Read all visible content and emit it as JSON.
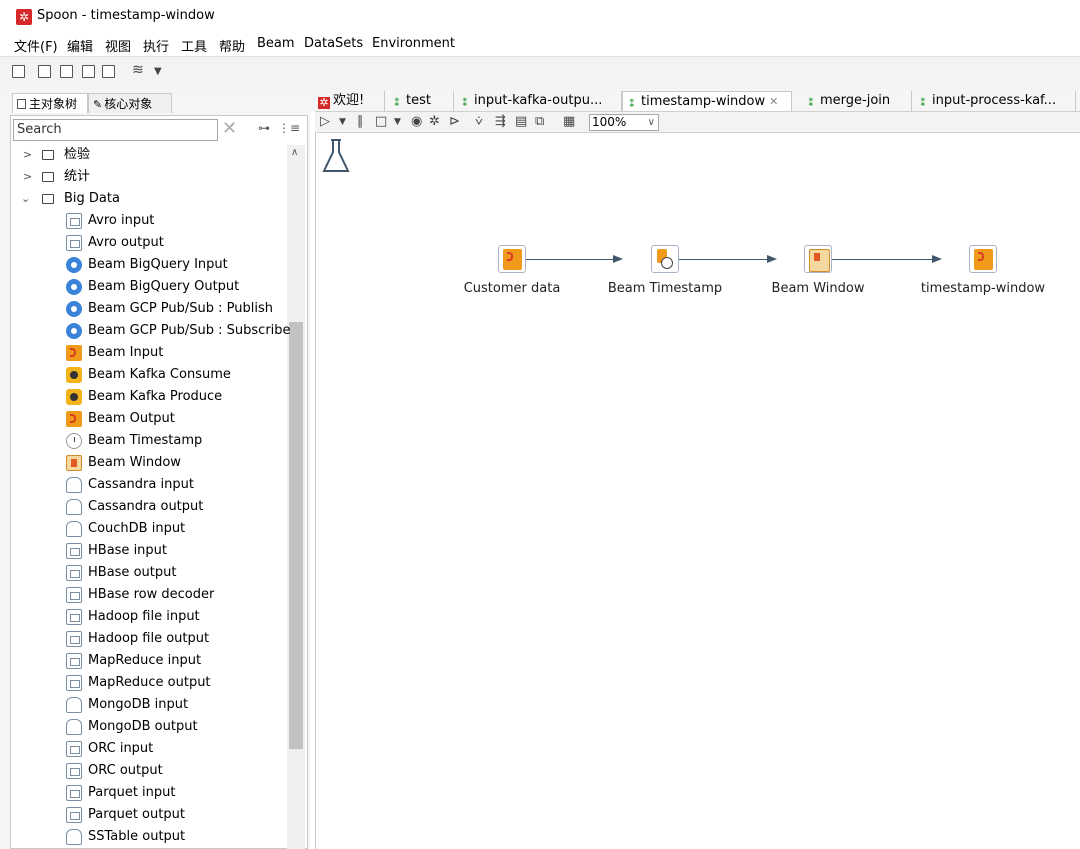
{
  "window": {
    "title": "Spoon - timestamp-window",
    "icon": "spoon-app-icon"
  },
  "menubar": [
    "文件(F)",
    "编辑",
    "视图",
    "执行",
    "工具",
    "帮助",
    "Beam",
    "DataSets",
    "Environment"
  ],
  "toolbar": {
    "icons": [
      "new-file-icon",
      "open-file-icon",
      "explore-repository-icon",
      "save-icon",
      "save-as-icon",
      "perspective-icon",
      "dropdown-arrow-icon"
    ]
  },
  "left_panel": {
    "tabs": [
      "主对象树",
      "核心对象"
    ],
    "search": {
      "placeholder": "Search",
      "value": ""
    },
    "tree": {
      "folders_above": [
        "检验",
        "统计"
      ],
      "open_folder": "Big Data",
      "items": [
        {
          "label": "Avro input",
          "icon": "avro-input-icon"
        },
        {
          "label": "Avro output",
          "icon": "avro-output-icon"
        },
        {
          "label": "Beam BigQuery Input",
          "icon": "bigquery-input-icon"
        },
        {
          "label": "Beam BigQuery Output",
          "icon": "bigquery-output-icon"
        },
        {
          "label": "Beam GCP Pub/Sub : Publish",
          "icon": "pubsub-publish-icon"
        },
        {
          "label": "Beam GCP Pub/Sub : Subscribe",
          "icon": "pubsub-subscribe-icon"
        },
        {
          "label": "Beam Input",
          "icon": "beam-input-icon"
        },
        {
          "label": "Beam Kafka Consume",
          "icon": "kafka-consume-icon"
        },
        {
          "label": "Beam Kafka Produce",
          "icon": "kafka-produce-icon"
        },
        {
          "label": "Beam Output",
          "icon": "beam-output-icon"
        },
        {
          "label": "Beam Timestamp",
          "icon": "beam-timestamp-icon"
        },
        {
          "label": "Beam Window",
          "icon": "beam-window-icon"
        },
        {
          "label": "Cassandra input",
          "icon": "cassandra-input-icon"
        },
        {
          "label": "Cassandra output",
          "icon": "cassandra-output-icon"
        },
        {
          "label": "CouchDB input",
          "icon": "couchdb-input-icon"
        },
        {
          "label": "HBase input",
          "icon": "hbase-input-icon"
        },
        {
          "label": "HBase output",
          "icon": "hbase-output-icon"
        },
        {
          "label": "HBase row decoder",
          "icon": "hbase-row-decoder-icon"
        },
        {
          "label": "Hadoop file input",
          "icon": "hadoop-file-input-icon"
        },
        {
          "label": "Hadoop file output",
          "icon": "hadoop-file-output-icon"
        },
        {
          "label": "MapReduce input",
          "icon": "mapreduce-input-icon"
        },
        {
          "label": "MapReduce output",
          "icon": "mapreduce-output-icon"
        },
        {
          "label": "MongoDB input",
          "icon": "mongodb-input-icon"
        },
        {
          "label": "MongoDB output",
          "icon": "mongodb-output-icon"
        },
        {
          "label": "ORC input",
          "icon": "orc-input-icon"
        },
        {
          "label": "ORC output",
          "icon": "orc-output-icon"
        },
        {
          "label": "Parquet input",
          "icon": "parquet-input-icon"
        },
        {
          "label": "Parquet output",
          "icon": "parquet-output-icon"
        },
        {
          "label": "SSTable output",
          "icon": "sstable-output-icon"
        }
      ]
    }
  },
  "editor": {
    "tabs": [
      {
        "label": "欢迎!",
        "icon": "welcome-icon",
        "active": false
      },
      {
        "label": "test",
        "icon": "transformation-icon",
        "active": false
      },
      {
        "label": "input-kafka-outpu...",
        "icon": "transformation-icon",
        "active": false
      },
      {
        "label": "timestamp-window",
        "icon": "transformation-icon",
        "active": true
      },
      {
        "label": "merge-join",
        "icon": "transformation-icon",
        "active": false
      },
      {
        "label": "input-process-kaf...",
        "icon": "transformation-icon",
        "active": false
      }
    ],
    "toolbar_icons": [
      "run-icon",
      "run-dropdown-icon",
      "pause-icon",
      "stop-icon",
      "stop-dropdown-icon",
      "preview-icon",
      "debug-icon",
      "replay-icon",
      "verify-icon",
      "impact-icon",
      "sql-icon",
      "explore-db-icon",
      "show-results-icon"
    ],
    "zoom": "100%",
    "steps": [
      {
        "label": "Customer data",
        "icon": "beam-input-icon"
      },
      {
        "label": "Beam Timestamp",
        "icon": "beam-timestamp-icon"
      },
      {
        "label": "Beam Window",
        "icon": "beam-window-icon"
      },
      {
        "label": "timestamp-window",
        "icon": "beam-output-icon"
      }
    ]
  },
  "colors": {
    "beam_orange": "#f09a1b",
    "beam_red": "#d83b1e",
    "hop_line": "#42576b",
    "transformation_green": "#2e9e3a",
    "app_red": "#d62828"
  }
}
